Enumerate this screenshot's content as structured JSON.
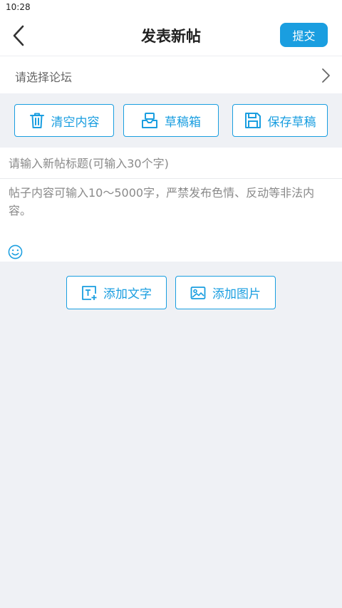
{
  "status_bar": {
    "time": "10:28"
  },
  "nav": {
    "back_icon": "chevron-left-icon",
    "title": "发表新帖",
    "submit_label": "提交"
  },
  "forum": {
    "label": "请选择论坛",
    "arrow_icon": "chevron-right-icon"
  },
  "toolbar": {
    "clear_label": "清空内容",
    "clear_icon": "trash-icon",
    "drafts_label": "草稿箱",
    "drafts_icon": "inbox-icon",
    "save_label": "保存草稿",
    "save_icon": "floppy-disk-icon"
  },
  "title_input": {
    "placeholder": "请输入新帖标题(可输入30个字)",
    "value": ""
  },
  "content_input": {
    "placeholder": "帖子内容可输入10～5000字，严禁发布色情、反动等非法内容。",
    "value": ""
  },
  "emoji": {
    "icon": "smiley-icon"
  },
  "add_actions": {
    "add_text_label": "添加文字",
    "add_text_icon": "text-box-icon",
    "add_image_label": "添加图片",
    "add_image_icon": "image-icon"
  },
  "colors": {
    "accent": "#1a9ee0",
    "background": "#eff1f5",
    "placeholder": "#8a8a8a"
  }
}
